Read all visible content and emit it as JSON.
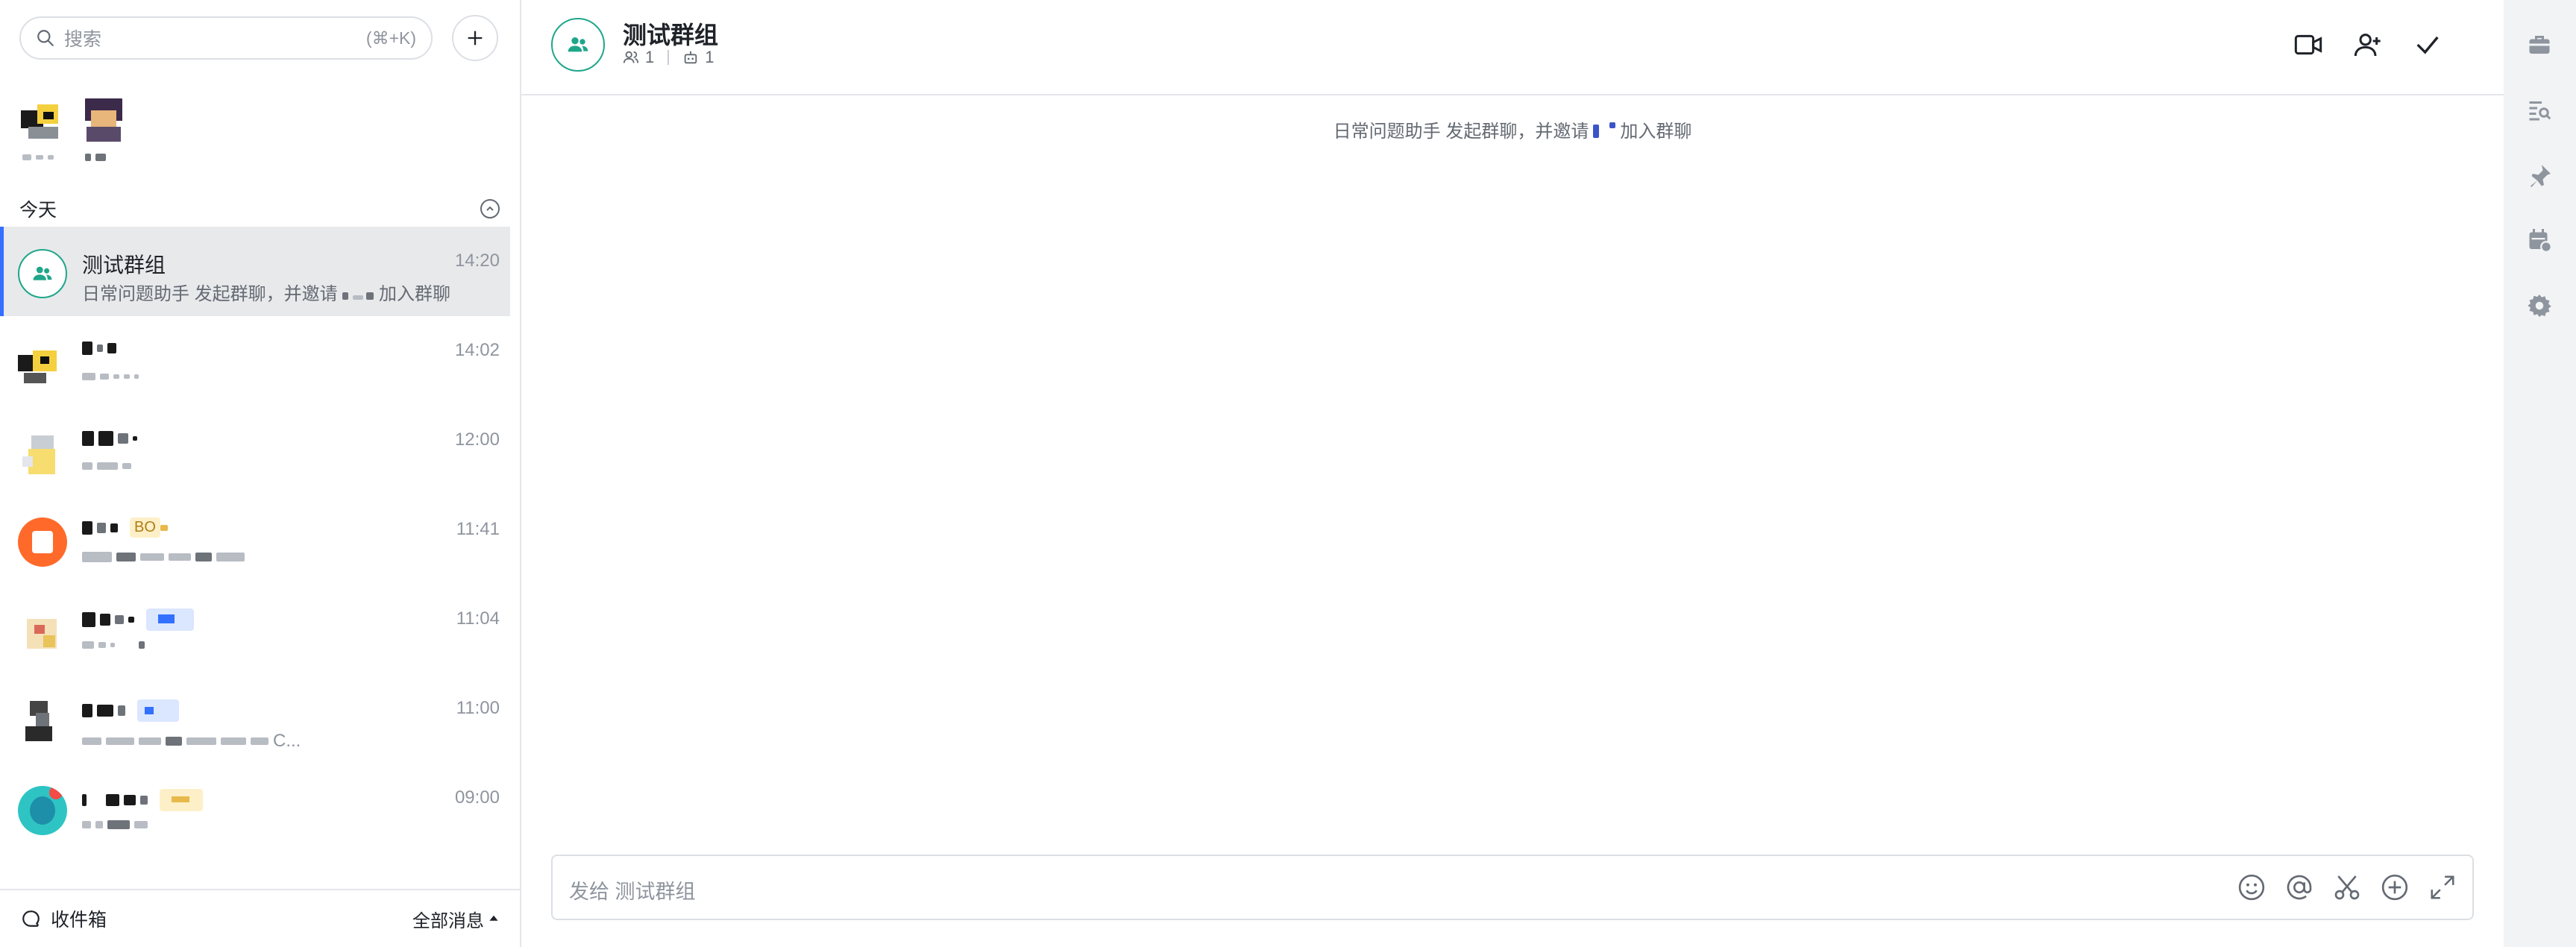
{
  "search": {
    "placeholder": "搜索",
    "shortcut": "(⌘+K)"
  },
  "sidebar": {
    "today_label": "今天",
    "chats": [
      {
        "name": "测试群组",
        "time": "14:20",
        "preview_start": "日常问题助手 发起群聊，并邀请",
        "preview_end": "加入群聊"
      },
      {
        "time": "14:02"
      },
      {
        "time": "12:00"
      },
      {
        "time": "11:41",
        "tag": "BO"
      },
      {
        "time": "11:04"
      },
      {
        "time": "11:00",
        "preview_tail": "C..."
      },
      {
        "time": "09:00"
      }
    ],
    "footer": {
      "inbox_label": "收件箱",
      "filter_label": "全部消息"
    }
  },
  "header": {
    "title": "测试群组",
    "member_count": "1",
    "bot_count": "1"
  },
  "messages": {
    "system_start": "日常问题助手 发起群聊，并邀请",
    "system_end": "加入群聊"
  },
  "composer": {
    "placeholder": "发给 测试群组"
  },
  "colors": {
    "accent": "#3370ff",
    "group_green": "#1fa68a",
    "rail_bg": "#f2f3f5"
  }
}
